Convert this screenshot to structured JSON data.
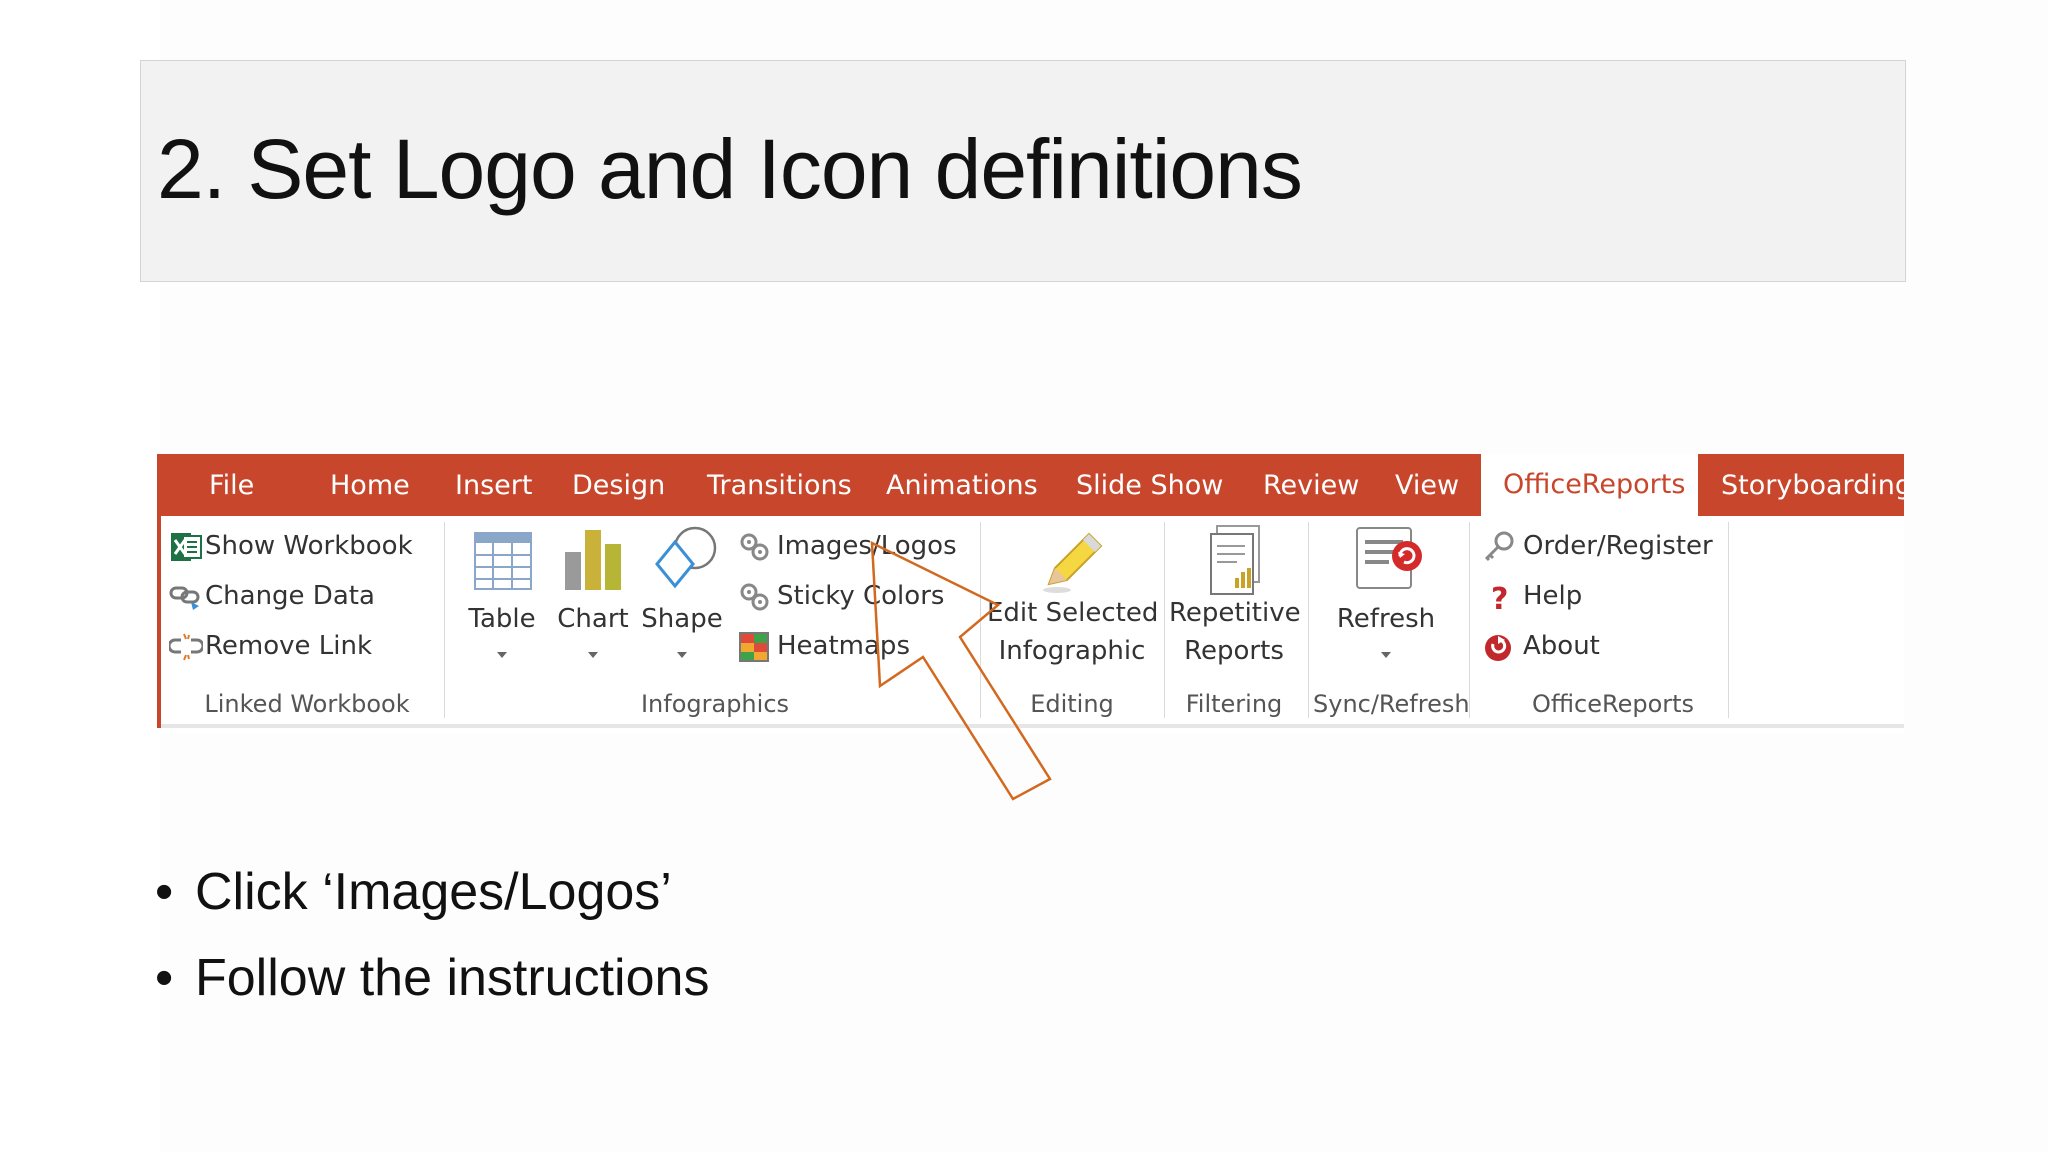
{
  "slide": {
    "title": "2. Set Logo and Icon definitions",
    "bullets": [
      "Click ‘Images/Logos’",
      "Follow the instructions"
    ]
  },
  "ribbon": {
    "accent_color": "#c8472c",
    "tabs": [
      "File",
      "Home",
      "Insert",
      "Design",
      "Transitions",
      "Animations",
      "Slide Show",
      "Review",
      "View",
      "OfficeReports",
      "Storyboarding"
    ],
    "active_tab": "OfficeReports",
    "groups": {
      "linked_workbook": {
        "label": "Linked Workbook",
        "items": [
          "Show Workbook",
          "Change Data",
          "Remove Link"
        ]
      },
      "infographics": {
        "label": "Infographics",
        "buttons": [
          "Table",
          "Chart",
          "Shape"
        ],
        "items": [
          "Images/Logos",
          "Sticky Colors",
          "Heatmaps"
        ]
      },
      "editing": {
        "label": "Editing",
        "button_line1": "Edit Selected",
        "button_line2": "Infographic"
      },
      "filtering": {
        "label": "Filtering",
        "button_line1": "Repetitive",
        "button_line2": "Reports"
      },
      "sync_refresh": {
        "label": "Sync/Refresh",
        "button": "Refresh"
      },
      "officereports": {
        "label": "OfficeReports",
        "items": [
          "Order/Register",
          "Help",
          "About"
        ]
      }
    }
  },
  "icons": {
    "excel": "excel-icon",
    "change_data": "link-change-icon",
    "remove_link": "broken-link-icon",
    "table": "table-icon",
    "chart": "bar-chart-icon",
    "shape": "shape-icon",
    "images": "gears-icon",
    "heatmaps": "heatmap-icon",
    "pencil": "pencil-icon",
    "report": "report-icon",
    "refresh": "refresh-icon",
    "key": "key-icon",
    "help": "question-icon",
    "about": "about-icon",
    "pointer": "pointer-arrow-icon"
  }
}
